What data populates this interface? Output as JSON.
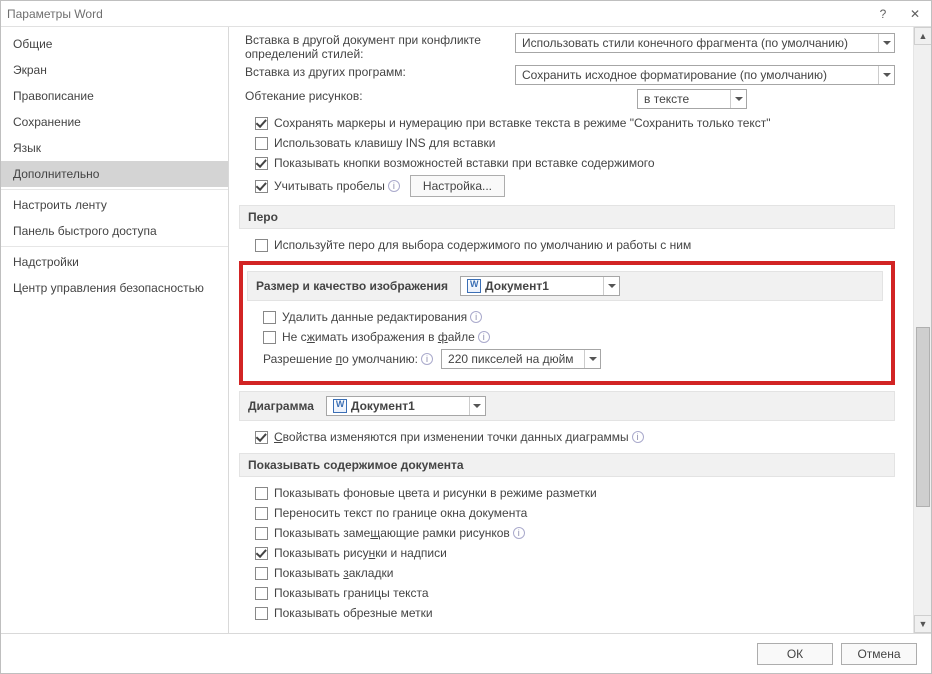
{
  "window": {
    "title": "Параметры Word"
  },
  "nav": {
    "items": [
      "Общие",
      "Экран",
      "Правописание",
      "Сохранение",
      "Язык",
      "Дополнительно",
      "Настроить ленту",
      "Панель быстрого доступа",
      "Надстройки",
      "Центр управления безопасностью"
    ],
    "active_index": 5,
    "separators_before": [
      6,
      8
    ]
  },
  "paste": {
    "label_conflict_a": "Вставка в другой документ при конфликте",
    "label_conflict_b": "определений стилей:",
    "combo_conflict": "Использовать стили конечного фрагмента (по умолчанию)",
    "label_other": "Вставка из других программ:",
    "combo_other": "Сохранить исходное форматирование (по умолчанию)",
    "label_wrap": "Обтекание рисунков:",
    "combo_wrap": "в тексте",
    "cb_keep_bullets": "Сохранять маркеры и нумерацию при вставке текста в режиме \"Сохранить только текст\"",
    "cb_ins_key": "Использовать клавишу INS для вставки",
    "cb_paste_btn": "Показывать кнопки возможностей вставки при вставке содержимого",
    "cb_smart": "Учитывать пробелы",
    "btn_settings": "Настройка..."
  },
  "pen": {
    "heading": "Перо",
    "cb_pen": "Используйте перо для выбора содержимого по умолчанию и работы с ним"
  },
  "image": {
    "heading": "Размер и качество изображения",
    "doc": "Документ1",
    "cb_discard": "Удалить данные редактирования",
    "cb_nocompress": "Не сжимать изображения в файле",
    "label_res": "Разрешение по умолчанию:",
    "combo_res": "220 пикселей на дюйм"
  },
  "chart": {
    "heading": "Диаграмма",
    "doc": "Документ1",
    "cb_props": "Свойства изменяются при изменении точки данных диаграммы"
  },
  "show": {
    "heading": "Показывать содержимое документа",
    "cb_bg": "Показывать фоновые цвета и рисунки в режиме разметки",
    "cb_wrap": "Переносить текст по границе окна документа",
    "cb_ph": "Показывать замещающие рамки рисунков",
    "cb_drawings": "Показывать рисунки и надписи",
    "cb_bookmarks": "Показывать закладки",
    "cb_borders": "Показывать границы текста",
    "cb_crop": "Показывать обрезные метки"
  },
  "footer": {
    "ok": "ОК",
    "cancel": "Отмена"
  }
}
